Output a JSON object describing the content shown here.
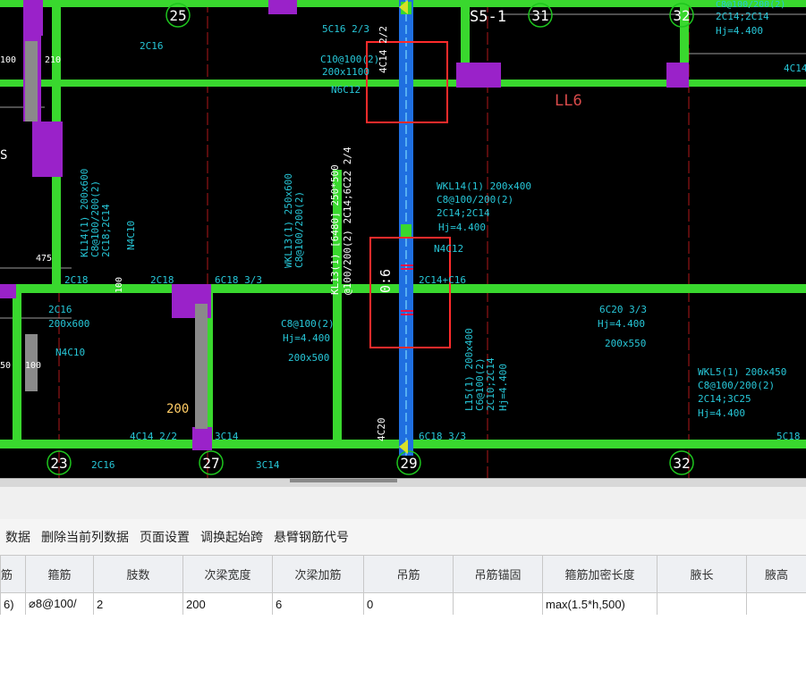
{
  "cad": {
    "axis_numbers": [
      "25",
      "31",
      "32",
      "23",
      "27",
      "29",
      "32"
    ],
    "section_label": "S5-1",
    "beam_LL6": "LL6",
    "labels": {
      "a1": "5C16 2/3",
      "a2": "C10@100(2)",
      "a3": "200x1100",
      "a4": "N6C12",
      "a5": "4C14 2/2",
      "a6": "2C16",
      "b1": "WKL14(1) 200x400",
      "b2": "C8@100/200(2)",
      "b3": "2C14;2C14",
      "b4": "Hj=4.400",
      "b5": "N4C12",
      "b6": "2C14+C16",
      "c1": "KL14(1) 200x600",
      "c2": "C8@100/200(2)",
      "c3": "2C18;2C14",
      "c4": "N4C10",
      "d1": "WKL13(1) 250x600",
      "d2": "C8@100/200(2)",
      "e1": "KL13(1) [6480] 250*500",
      "e2": "@100/200(2) 2C14;6C22 2/4",
      "f1": "2C18",
      "f2": "2C18",
      "f3": "6C18 3/3",
      "f4": "0:6",
      "g1": "2C16",
      "g2": "200x600",
      "g3": "N4C10",
      "h1": "C8@100(2)",
      "h2": "Hj=4.400",
      "h3": "200x500",
      "i1": "6C20 3/3",
      "i2": "Hj=4.400",
      "i3": "200x550",
      "j1": "L15(1) 200x400",
      "j2": "C6@100(2)",
      "j3": "2C10;2C14",
      "j4": "Hj=4.400",
      "k1": "WKL5(1) 200x450",
      "k2": "C8@100/200(2)",
      "k3": "2C14;3C25",
      "k4": "Hj=4.400",
      "l1": "4C14 2/2",
      "l2": "3C14",
      "l3": "2C16",
      "l4": "3C14",
      "l5": "6C18 3/3",
      "l6": "5C18",
      "l7": "4C20",
      "n1": "200",
      "n2": "100",
      "n3": "210",
      "n4": "475",
      "n5": "50",
      "n6": "100",
      "n7": "100",
      "top1": "C8@100/200(2)",
      "top2": "2C14;2C14",
      "top3": "Hj=4.400",
      "top4": "4C14",
      "s1": "S"
    },
    "colors": {
      "background": "#000000",
      "beam_fill": "#39d82e",
      "column": "#9a22c9",
      "selected_beam": "#1f6fe0",
      "grid_line": "#b0171a",
      "axis_circle": "#1ec51e",
      "annotation": "#27c7d8",
      "highlight_box": "#ff2b2b"
    }
  },
  "toolbar": {
    "items": [
      "数据",
      "删除当前列数据",
      "页面设置",
      "调换起始跨",
      "悬臂钢筋代号"
    ]
  },
  "table": {
    "headers": [
      "筋",
      "箍筋",
      "肢数",
      "次梁宽度",
      "次梁加筋",
      "吊筋",
      "吊筋锚固",
      "箍筋加密长度",
      "腋长",
      "腋高"
    ],
    "header_prefix": "",
    "rows": [
      [
        "6)",
        "⌀8@100/",
        "2",
        "200",
        "6",
        "0",
        "",
        "max(1.5*h,500)",
        "",
        ""
      ]
    ]
  }
}
